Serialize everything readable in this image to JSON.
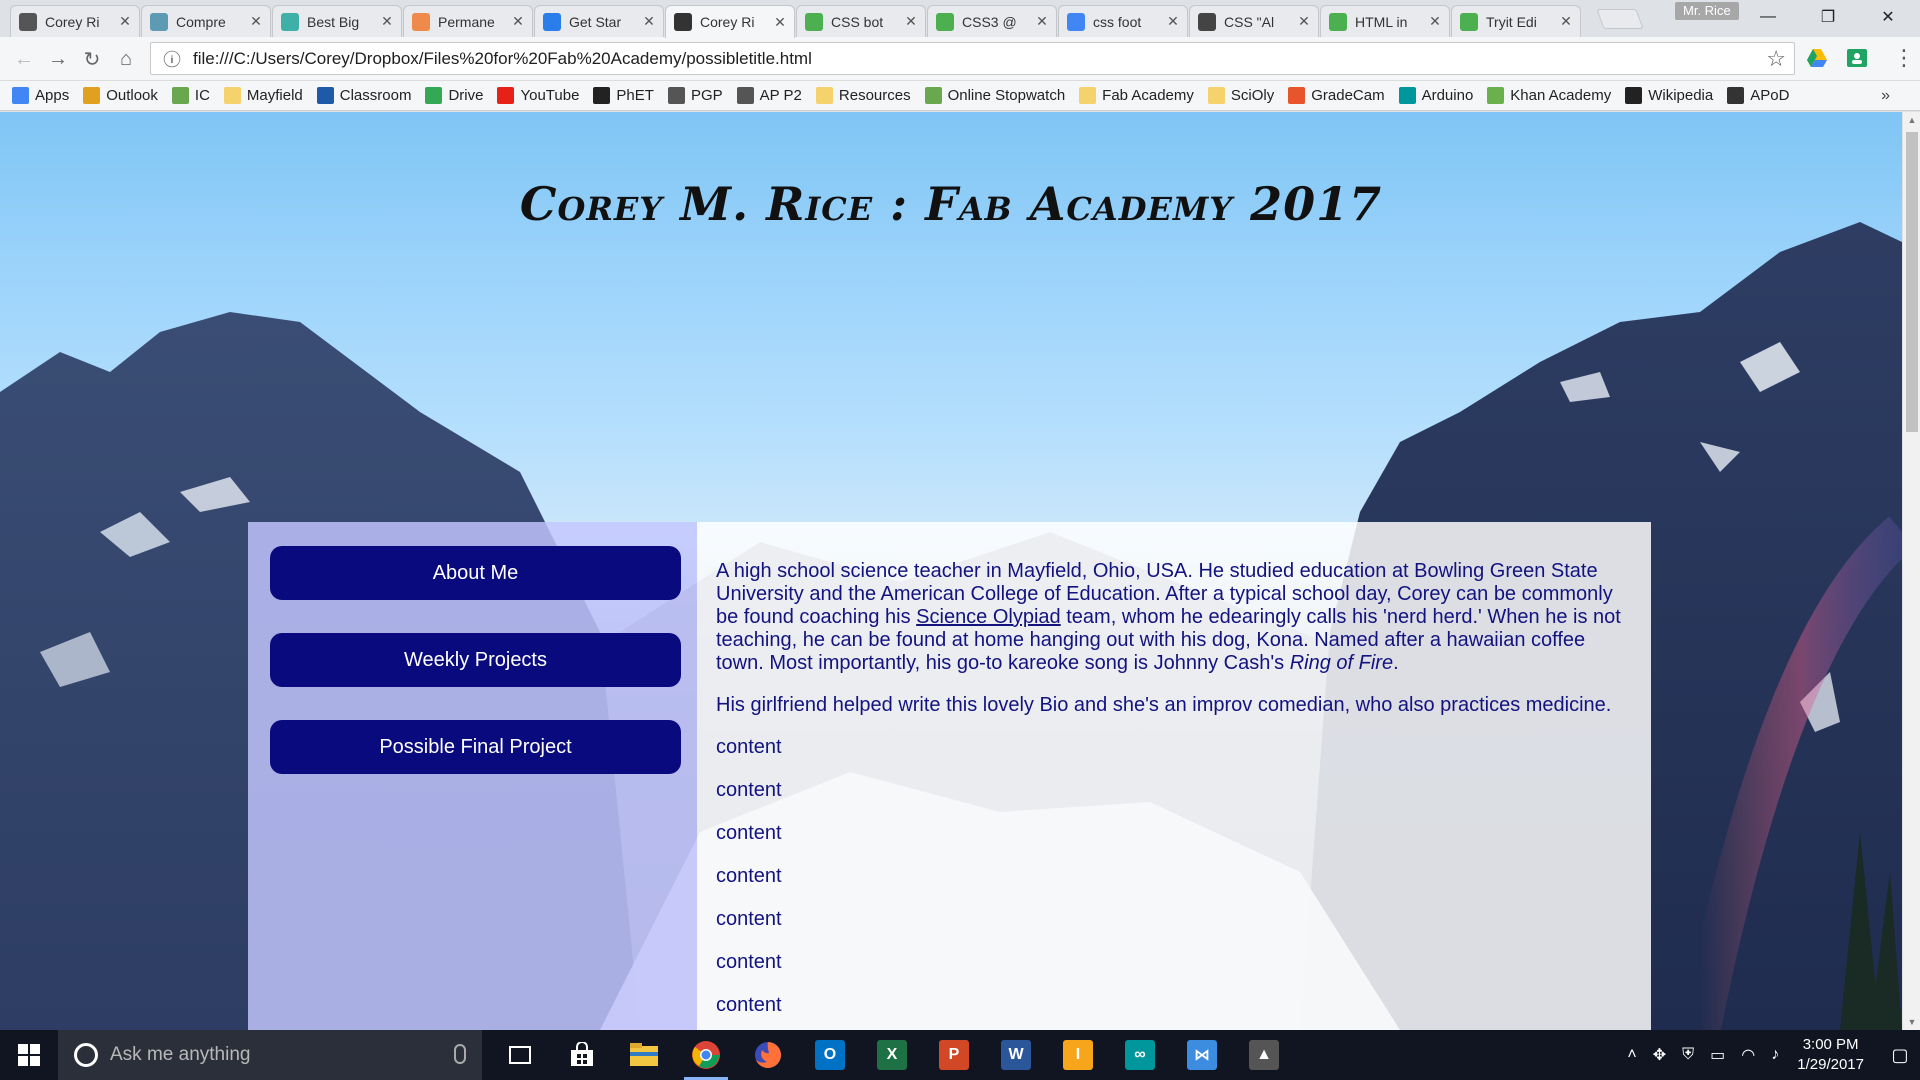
{
  "browser": {
    "tabs": [
      {
        "label": "Corey Ri",
        "icon": "mountain-icon",
        "color": "#555555",
        "active": false
      },
      {
        "label": "Compre",
        "icon": "leaf-icon",
        "color": "#5d9bb5",
        "active": false
      },
      {
        "label": "Best Big",
        "icon": "page-icon",
        "color": "#3fb0a8",
        "active": false
      },
      {
        "label": "Permane",
        "icon": "f-icon",
        "color": "#f08a4b",
        "active": false
      },
      {
        "label": "Get Star",
        "icon": "code-icon",
        "color": "#2b7de9",
        "active": false
      },
      {
        "label": "Corey Ri",
        "icon": "mountain-icon",
        "color": "#333333",
        "active": true
      },
      {
        "label": "CSS bot",
        "icon": "w3-icon",
        "color": "#4caf50",
        "active": false
      },
      {
        "label": "CSS3 @",
        "icon": "w3-icon",
        "color": "#4caf50",
        "active": false
      },
      {
        "label": "css foot",
        "icon": "google-icon",
        "color": "#4285f4",
        "active": false
      },
      {
        "label": "CSS \"Al",
        "icon": "globe-icon",
        "color": "#444444",
        "active": false
      },
      {
        "label": "HTML in",
        "icon": "w3-icon",
        "color": "#4caf50",
        "active": false
      },
      {
        "label": "Tryit Edi",
        "icon": "w3-icon",
        "color": "#4caf50",
        "active": false
      }
    ],
    "profile_name": "Mr. Rice",
    "window_controls": {
      "minimize": "—",
      "restore": "❐",
      "close": "✕"
    },
    "nav": {
      "back": "←",
      "forward": "→",
      "reload": "↻",
      "home": "⌂"
    },
    "omnibox": {
      "info": "i",
      "url": "file:///C:/Users/Corey/Dropbox/Files%20for%20Fab%20Academy/possibletitle.html",
      "star": "☆"
    },
    "menu": "⋮",
    "bookmarks": [
      {
        "label": "Apps",
        "icon": "apps-grid-icon",
        "color": "#4285f4"
      },
      {
        "label": "Outlook",
        "icon": "outlook-icon",
        "color": "#e0a020"
      },
      {
        "label": "IC",
        "icon": "c-icon",
        "color": "#6aa84f"
      },
      {
        "label": "Mayfield",
        "icon": "folder-icon",
        "color": "#f5d26b"
      },
      {
        "label": "Classroom",
        "icon": "classroom-icon",
        "color": "#1e5aa8"
      },
      {
        "label": "Drive",
        "icon": "drive-icon",
        "color": "#34a853"
      },
      {
        "label": "YouTube",
        "icon": "youtube-icon",
        "color": "#e62117"
      },
      {
        "label": "PhET",
        "icon": "phet-icon",
        "color": "#222222"
      },
      {
        "label": "PGP",
        "icon": "pinwheel-icon",
        "color": "#555555"
      },
      {
        "label": "AP P2",
        "icon": "shield-icon",
        "color": "#555555"
      },
      {
        "label": "Resources",
        "icon": "folder-icon",
        "color": "#f5d26b"
      },
      {
        "label": "Online Stopwatch",
        "icon": "stopwatch-icon",
        "color": "#6aa84f"
      },
      {
        "label": "Fab Academy",
        "icon": "folder-icon",
        "color": "#f5d26b"
      },
      {
        "label": "SciOly",
        "icon": "folder-icon",
        "color": "#f5d26b"
      },
      {
        "label": "GradeCam",
        "icon": "gradecam-icon",
        "color": "#e8542c"
      },
      {
        "label": "Arduino",
        "icon": "arduino-icon",
        "color": "#00979c"
      },
      {
        "label": "Khan Academy",
        "icon": "khan-icon",
        "color": "#6ab04c"
      },
      {
        "label": "Wikipedia",
        "icon": "wikipedia-icon",
        "color": "#222222"
      },
      {
        "label": "APoD",
        "icon": "apod-icon",
        "color": "#333333"
      }
    ],
    "bookmarks_overflow": "»"
  },
  "page": {
    "title": "Corey M. Rice : Fab Academy 2017",
    "nav": [
      {
        "label": "About Me"
      },
      {
        "label": "Weekly Projects"
      },
      {
        "label": "Possible Final Project"
      }
    ],
    "bio": {
      "part1": "A high school science teacher in Mayfield, Ohio, USA. He studied education at Bowling Green State University and the American College of Education. After a typical school day, Corey can be commonly be found coaching his ",
      "link": "Science Olypiad",
      "part2": " team, whom he edearingly calls his 'nerd herd.' When he is not teaching, he can be found at home hanging out with his dog, Kona. Named after a hawaiian coffee town. Most importantly, his go-to kareoke song is Johnny Cash's ",
      "song": "Ring of Fire",
      "part3": "."
    },
    "bio2": "His girlfriend helped write this lovely Bio and she's an improv comedian, who also practices medicine.",
    "filler": [
      "content",
      "content",
      "content",
      "content",
      "content",
      "content",
      "content"
    ],
    "colors": {
      "button_bg": "#0a0a7f",
      "text": "#131380",
      "sidebar_bg": "#c4c7ff"
    }
  },
  "taskbar": {
    "search_placeholder": "Ask me anything",
    "apps": [
      {
        "name": "task-view",
        "label": "",
        "color": "transparent",
        "running": false
      },
      {
        "name": "store",
        "label": "",
        "color": "#ffffff",
        "running": false
      },
      {
        "name": "file-explorer",
        "label": "",
        "color": "#f2c641",
        "running": false
      },
      {
        "name": "chrome",
        "label": "",
        "color": "#ea4335",
        "running": true
      },
      {
        "name": "firefox",
        "label": "",
        "color": "#ff7139",
        "running": false
      },
      {
        "name": "outlook",
        "label": "O",
        "color": "#0072c6",
        "running": false
      },
      {
        "name": "excel",
        "label": "X",
        "color": "#1e7145",
        "running": false
      },
      {
        "name": "powerpoint",
        "label": "P",
        "color": "#d24726",
        "running": false
      },
      {
        "name": "word",
        "label": "W",
        "color": "#2b579a",
        "running": false
      },
      {
        "name": "illustrator",
        "label": "I",
        "color": "#f7a51b",
        "running": false
      },
      {
        "name": "arduino",
        "label": "∞",
        "color": "#00979c",
        "running": false
      },
      {
        "name": "visual-studio",
        "label": "⋈",
        "color": "#3c8ce0",
        "running": false
      },
      {
        "name": "inkscape",
        "label": "▲",
        "color": "#555555",
        "running": false
      }
    ],
    "time": "3:00 PM",
    "date": "1/29/2017"
  }
}
